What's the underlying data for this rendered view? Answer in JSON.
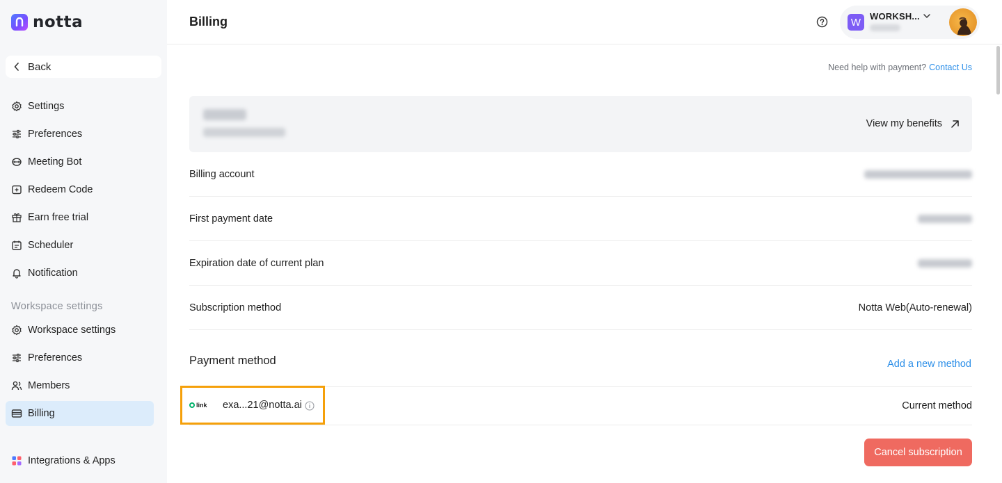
{
  "app": {
    "logo_text": "notta"
  },
  "sidebar": {
    "back_label": "Back",
    "account_items": [
      {
        "label": "Settings",
        "icon": "gear-icon"
      },
      {
        "label": "Preferences",
        "icon": "sliders-icon"
      },
      {
        "label": "Meeting Bot",
        "icon": "bot-icon"
      },
      {
        "label": "Redeem Code",
        "icon": "redeem-icon"
      },
      {
        "label": "Earn free trial",
        "icon": "gift-icon"
      },
      {
        "label": "Scheduler",
        "icon": "calendar-icon"
      },
      {
        "label": "Notification",
        "icon": "bell-icon"
      }
    ],
    "workspace_section_label": "Workspace settings",
    "workspace_items": [
      {
        "label": "Workspace settings",
        "icon": "gear-icon"
      },
      {
        "label": "Preferences",
        "icon": "sliders-icon"
      },
      {
        "label": "Members",
        "icon": "members-icon"
      },
      {
        "label": "Billing",
        "icon": "card-icon",
        "active": true
      }
    ],
    "integrations_label": "Integrations & Apps"
  },
  "header": {
    "title": "Billing",
    "workspace_badge": "W",
    "workspace_name": "WORKSH..."
  },
  "billing": {
    "help_text": "Need help with payment?",
    "contact_label": "Contact Us",
    "view_benefits_label": "View my benefits",
    "rows": [
      {
        "label": "Billing account",
        "value": ""
      },
      {
        "label": "First payment date",
        "value": ""
      },
      {
        "label": "Expiration date of current plan",
        "value": ""
      },
      {
        "label": "Subscription method",
        "value": "Notta Web(Auto-renewal)"
      }
    ],
    "payment_method_title": "Payment method",
    "add_method_label": "Add a new method",
    "method": {
      "provider": "link",
      "email": "exa...21@notta.ai",
      "status": "Current method"
    },
    "cancel_label": "Cancel subscription"
  },
  "colors": {
    "accent": "#2b8ee8",
    "active_nav": "#dcecfb",
    "danger": "#ef6a60",
    "highlight": "#f5a00a",
    "workspace_badge": "#7d5cf5"
  }
}
